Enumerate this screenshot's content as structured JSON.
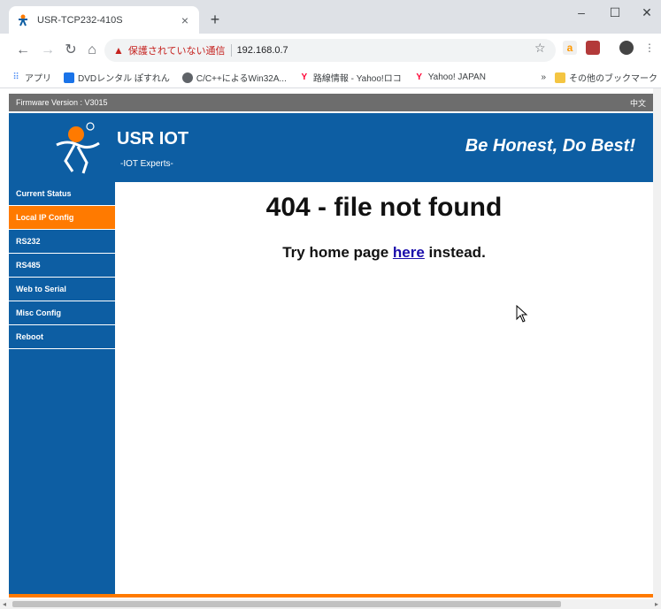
{
  "browser": {
    "tab_title": "USR-TCP232-410S",
    "tab_close": "×",
    "new_tab": "+",
    "win_minimize": "–",
    "win_maximize": "☐",
    "win_close": "✕",
    "security_warning": "保護されていない通信",
    "url": "192.168.0.7",
    "bookmarks": [
      {
        "label": "アプリ",
        "icon": "apps-grid-icon"
      },
      {
        "label": "DVDレンタル ぽすれん",
        "icon": "bookmark-favicon"
      },
      {
        "label": "C/C++によるWin32A...",
        "icon": "chrome-favicon"
      },
      {
        "label": "路線情報 - Yahoo!ロコ",
        "icon": "yahoo-favicon"
      },
      {
        "label": "Yahoo! JAPAN",
        "icon": "yahoo-favicon"
      }
    ],
    "overflow": "»",
    "other_bookmarks": "その他のブックマーク"
  },
  "page": {
    "firmware": "Firmware Version : V3015",
    "lang": "中文",
    "brand": "USR IOT",
    "brand_sub": "-IOT Experts-",
    "slogan": "Be Honest, Do Best!",
    "nav": [
      {
        "label": "Current Status",
        "active": false
      },
      {
        "label": "Local IP Config",
        "active": true
      },
      {
        "label": "RS232",
        "active": false
      },
      {
        "label": "RS485",
        "active": false
      },
      {
        "label": "Web to Serial",
        "active": false
      },
      {
        "label": "Misc Config",
        "active": false
      },
      {
        "label": "Reboot",
        "active": false
      }
    ],
    "error_title": "404 - file not found",
    "error_pre": "Try home page ",
    "error_link": "here",
    "error_post": " instead."
  },
  "colors": {
    "header_blue": "#0d5ea3",
    "active_orange": "#ff7a00",
    "firmware_bar": "#6d6d6d"
  }
}
